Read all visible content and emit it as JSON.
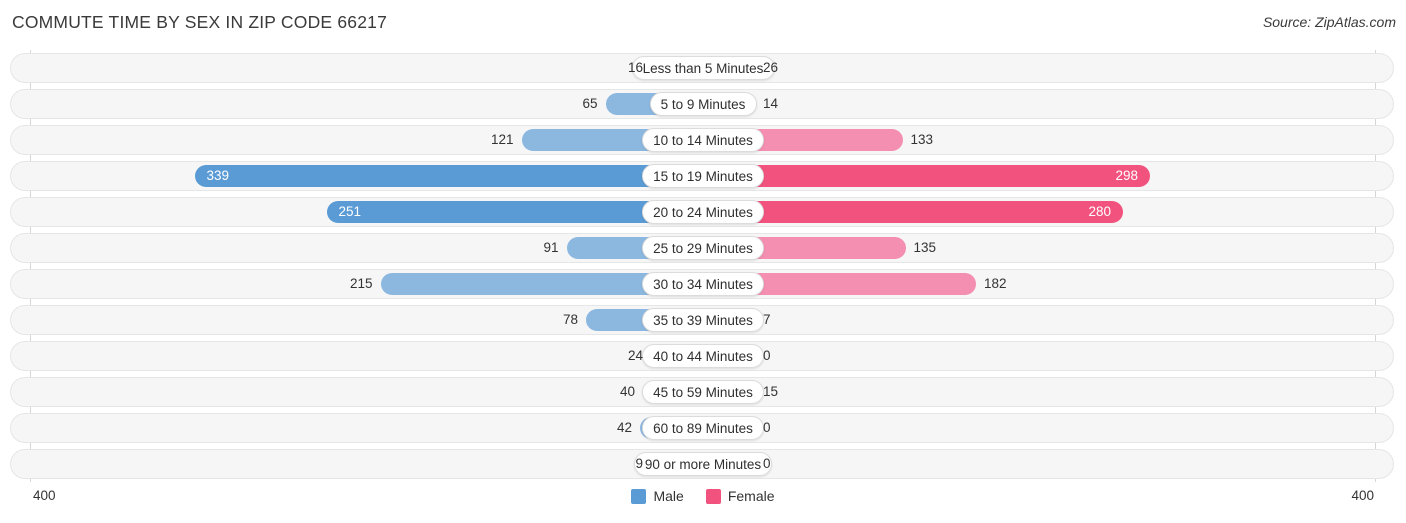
{
  "header": {
    "title": "COMMUTE TIME BY SEX IN ZIP CODE 66217",
    "source": "Source: ZipAtlas.com"
  },
  "axis": {
    "left_tick": "400",
    "right_tick": "400"
  },
  "legend": {
    "items": [
      {
        "label": "Male",
        "color": "#5b9bd5"
      },
      {
        "label": "Female",
        "color": "#f2537e"
      }
    ]
  },
  "chart_data": {
    "type": "bar",
    "title": "COMMUTE TIME BY SEX IN ZIP CODE 66217",
    "subtype": "diverging-horizontal-bar",
    "xlabel": "",
    "ylabel": "",
    "xlim": [
      -400,
      400
    ],
    "axis_max": 400,
    "grid": false,
    "legend_position": "bottom-center",
    "categories": [
      "Less than 5 Minutes",
      "5 to 9 Minutes",
      "10 to 14 Minutes",
      "15 to 19 Minutes",
      "20 to 24 Minutes",
      "25 to 29 Minutes",
      "30 to 34 Minutes",
      "35 to 39 Minutes",
      "40 to 44 Minutes",
      "45 to 59 Minutes",
      "60 to 89 Minutes",
      "90 or more Minutes"
    ],
    "series": [
      {
        "name": "Male",
        "color": "#8cb8e0",
        "highlight_color": "#5b9bd5",
        "direction": "left",
        "values": [
          16,
          65,
          121,
          339,
          251,
          91,
          215,
          78,
          24,
          40,
          42,
          9
        ]
      },
      {
        "name": "Female",
        "color": "#f48fb1",
        "highlight_color": "#f2537e",
        "direction": "right",
        "values": [
          26,
          14,
          133,
          298,
          280,
          135,
          182,
          7,
          0,
          15,
          0,
          0
        ]
      }
    ]
  },
  "rows": [
    {
      "label": "Less than 5 Minutes",
      "male": "16",
      "female": "26"
    },
    {
      "label": "5 to 9 Minutes",
      "male": "65",
      "female": "14"
    },
    {
      "label": "10 to 14 Minutes",
      "male": "121",
      "female": "133"
    },
    {
      "label": "15 to 19 Minutes",
      "male": "339",
      "female": "298"
    },
    {
      "label": "20 to 24 Minutes",
      "male": "251",
      "female": "280"
    },
    {
      "label": "25 to 29 Minutes",
      "male": "91",
      "female": "135"
    },
    {
      "label": "30 to 34 Minutes",
      "male": "215",
      "female": "182"
    },
    {
      "label": "35 to 39 Minutes",
      "male": "78",
      "female": "7"
    },
    {
      "label": "40 to 44 Minutes",
      "male": "24",
      "female": "0"
    },
    {
      "label": "45 to 59 Minutes",
      "male": "40",
      "female": "15"
    },
    {
      "label": "60 to 89 Minutes",
      "male": "42",
      "female": "0"
    },
    {
      "label": "90 or more Minutes",
      "male": "9",
      "female": "0"
    }
  ]
}
